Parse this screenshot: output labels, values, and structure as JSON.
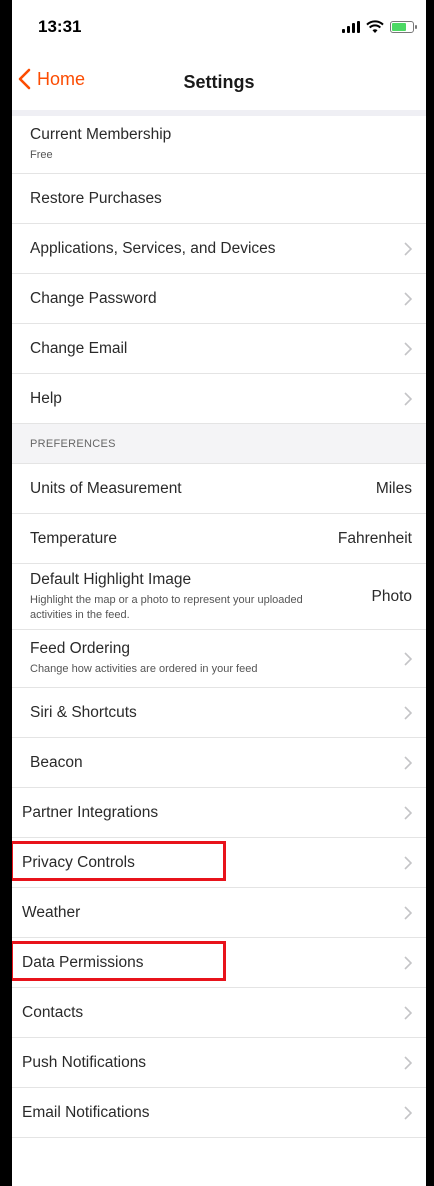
{
  "status_bar": {
    "time": "13:31"
  },
  "nav": {
    "back_label": "Home",
    "title": "Settings"
  },
  "account_rows": [
    {
      "label": "Current Membership",
      "sub": "Free"
    },
    {
      "label": "Restore Purchases"
    },
    {
      "label": "Applications, Services, and Devices"
    },
    {
      "label": "Change Password"
    },
    {
      "label": "Change Email"
    },
    {
      "label": "Help"
    }
  ],
  "preferences": {
    "header": "PREFERENCES",
    "units": {
      "label": "Units of Measurement",
      "value": "Miles"
    },
    "temperature": {
      "label": "Temperature",
      "value": "Fahrenheit"
    },
    "highlight_image": {
      "label": "Default Highlight Image",
      "sub": "Highlight the map or a photo to represent your uploaded activities in the feed.",
      "value": "Photo"
    },
    "feed_ordering": {
      "label": "Feed Ordering",
      "sub": "Change how activities are ordered in your feed"
    },
    "siri": {
      "label": "Siri & Shortcuts"
    },
    "beacon": {
      "label": "Beacon"
    }
  },
  "other_rows": [
    {
      "label": "Partner Integrations"
    },
    {
      "label": "Privacy Controls"
    },
    {
      "label": "Weather"
    },
    {
      "label": "Data Permissions"
    },
    {
      "label": "Contacts"
    },
    {
      "label": "Push Notifications"
    },
    {
      "label": "Email Notifications"
    }
  ],
  "colors": {
    "accent": "#fc4c02",
    "highlight": "#e8131b"
  },
  "icons": {
    "back": "chevron-left-icon",
    "disclosure": "chevron-right-icon"
  }
}
